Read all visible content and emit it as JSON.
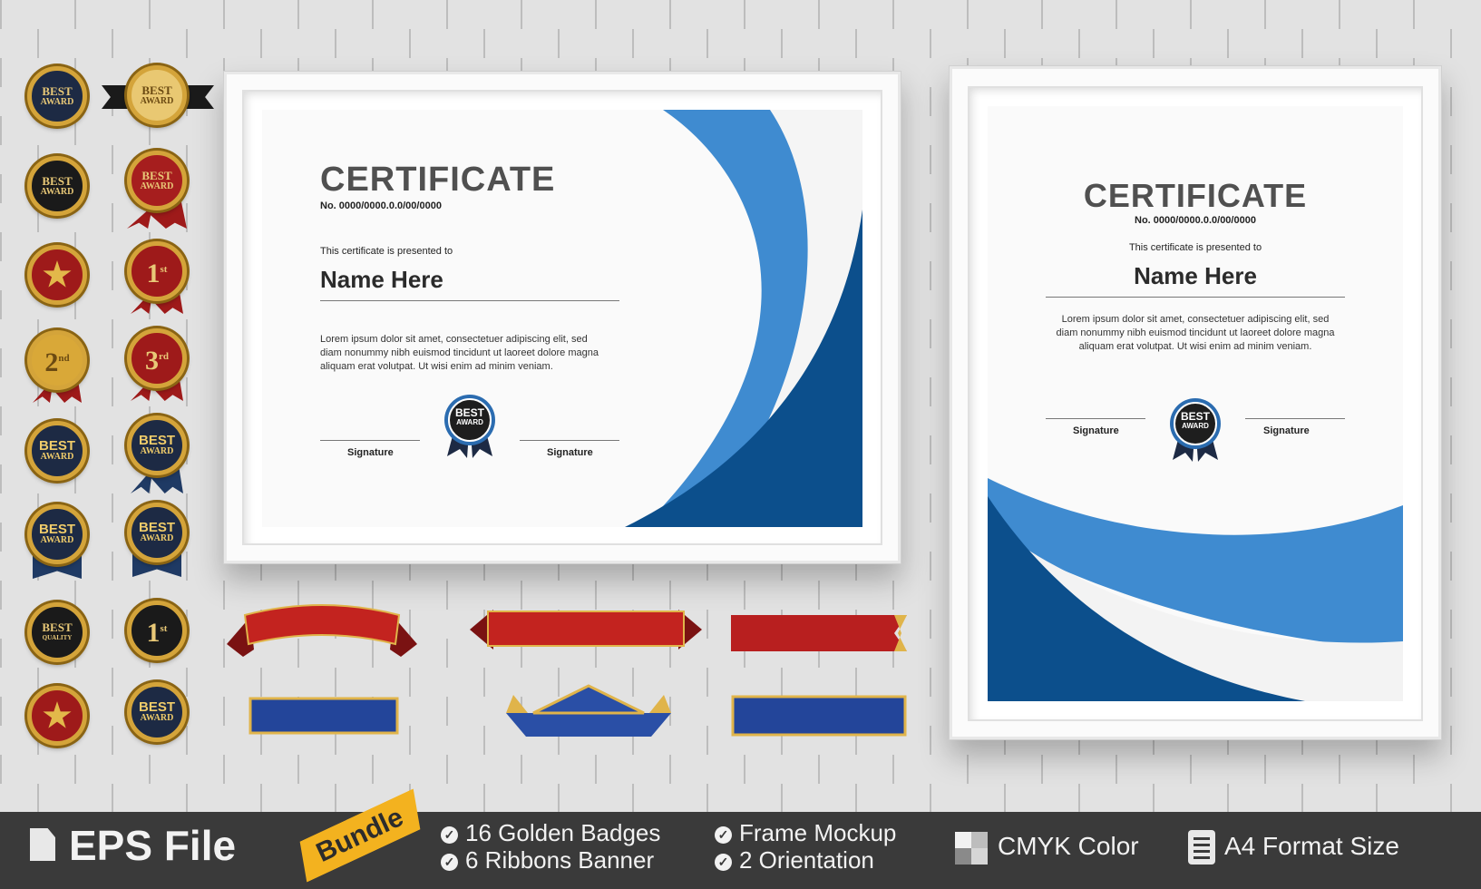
{
  "landscape_certificate": {
    "title": "CERTIFICATE",
    "number": "No. 0000/0000.0.0/00/0000",
    "presented": "This certificate is presented to",
    "name": "Name Here",
    "lorem_1": "Lorem ipsum dolor sit amet, consectetuer adipiscing elit, sed",
    "lorem_2": "diam nonummy nibh euismod tincidunt ut laoreet dolore magna",
    "lorem_3": "aliquam erat volutpat. Ut wisi enim ad minim veniam.",
    "signature_left": "Signature",
    "signature_right": "Signature",
    "seal_1": "BEST",
    "seal_2": "AWARD"
  },
  "portrait_certificate": {
    "title": "CERTIFICATE",
    "number": "No. 0000/0000.0.0/00/0000",
    "presented": "This certificate is presented to",
    "name": "Name Here",
    "lorem_1": "Lorem ipsum dolor sit amet, consectetuer adipiscing elit, sed",
    "lorem_2": "diam nonummy nibh euismod tincidunt ut laoreet dolore magna",
    "lorem_3": "aliquam erat volutpat. Ut wisi enim ad minim veniam.",
    "signature_left": "Signature",
    "signature_right": "Signature",
    "seal_1": "BEST",
    "seal_2": "AWARD"
  },
  "badges": {
    "best": "BEST",
    "award": "AWARD",
    "quality": "QUALITY",
    "first": "1",
    "first_sup": "st",
    "second": "2",
    "second_sup": "nd",
    "third": "3",
    "third_sup": "rd"
  },
  "bottom_bar": {
    "format": "EPS File",
    "bundle": "Bundle",
    "feature_1": "16 Golden Badges",
    "feature_2": "6  Ribbons Banner",
    "feature_3": "Frame Mockup",
    "feature_4": "2 Orientation",
    "color_mode": "CMYK Color",
    "size": "A4 Format Size"
  },
  "colors": {
    "light_blue": "#3f8bd0",
    "dark_blue": "#0c4f8c",
    "gold": "#d4a43a",
    "red": "#b3201c",
    "navy": "#1d2a44",
    "bar": "#3a3a3a"
  }
}
